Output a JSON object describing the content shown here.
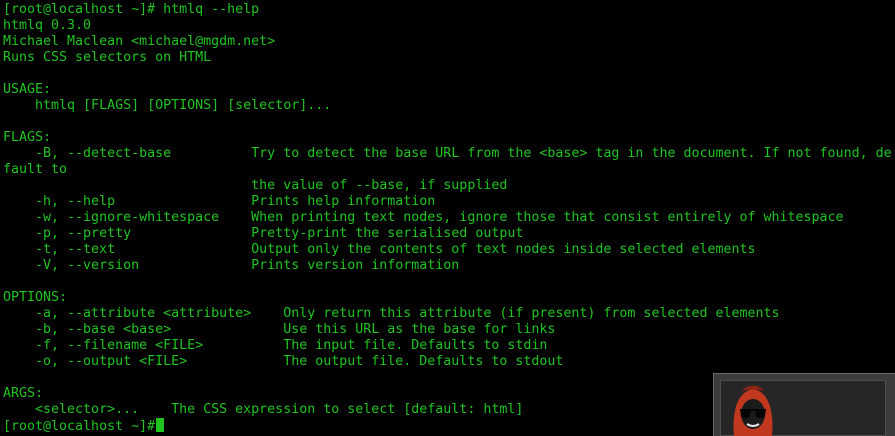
{
  "terminal": {
    "text_color": "#1fc41f",
    "background": "#000000",
    "prompt": "[root@localhost ~]#",
    "lines": [
      "[root@localhost ~]# htmlq --help",
      "htmlq 0.3.0",
      "Michael Maclean <michael@mgdm.net>",
      "Runs CSS selectors on HTML",
      "",
      "USAGE:",
      "    htmlq [FLAGS] [OPTIONS] [selector]...",
      "",
      "FLAGS:",
      "    -B, --detect-base          Try to detect the base URL from the <base> tag in the document. If not found, de",
      "fault to",
      "                               the value of --base, if supplied",
      "    -h, --help                 Prints help information",
      "    -w, --ignore-whitespace    When printing text nodes, ignore those that consist entirely of whitespace",
      "    -p, --pretty               Pretty-print the serialised output",
      "    -t, --text                 Output only the contents of text nodes inside selected elements",
      "    -V, --version              Prints version information",
      "",
      "OPTIONS:",
      "    -a, --attribute <attribute>    Only return this attribute (if present) from selected elements",
      "    -b, --base <base>              Use this URL as the base for links",
      "    -f, --filename <FILE>          The input file. Defaults to stdin",
      "    -o, --output <FILE>            The output file. Defaults to stdout",
      "",
      "ARGS:",
      "    <selector>...    The CSS expression to select [default: html]"
    ]
  },
  "overlay": {
    "avatar_icon": "sunglasses-avatar-icon",
    "avatar_color": "#c2381f"
  }
}
